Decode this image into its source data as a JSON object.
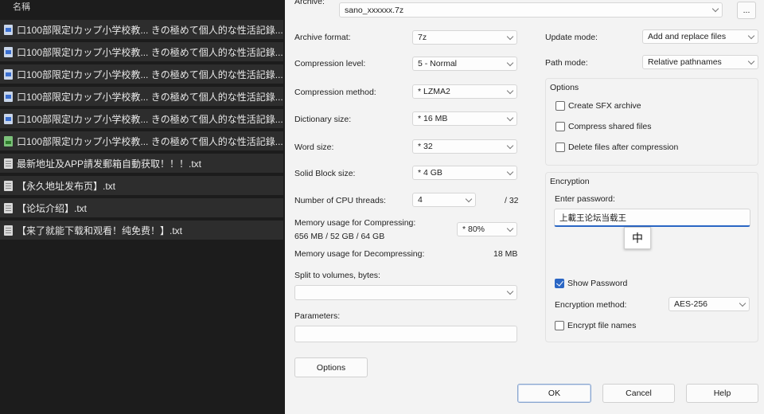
{
  "file_list": {
    "header": "名稱",
    "rows": [
      {
        "icon": "doc",
        "name": "口100部限定Iカップ小学校教... きの極めて個人的な性活記錄..."
      },
      {
        "icon": "doc",
        "name": "口100部限定Iカップ小学校教... きの極めて個人的な性活記錄..."
      },
      {
        "icon": "doc",
        "name": "口100部限定Iカップ小学校教... きの極めて個人的な性活記錄..."
      },
      {
        "icon": "doc",
        "name": "口100部限定Iカップ小学校教... きの極めて個人的な性活記錄..."
      },
      {
        "icon": "doc",
        "name": "口100部限定Iカップ小学校教... きの極めて個人的な性活記錄..."
      },
      {
        "icon": "img",
        "name": "口100部限定Iカップ小学校教... きの極めて個人的な性活記錄..."
      },
      {
        "icon": "txt",
        "name": "最新地址及APP請发郵箱自動获取！！！.txt"
      },
      {
        "icon": "txt",
        "name": "【永久地址发布页】.txt"
      },
      {
        "icon": "txt",
        "name": "【论坛介绍】.txt"
      },
      {
        "icon": "txt",
        "name": "【来了就能下载和观看！纯免费！】.txt"
      }
    ]
  },
  "dialog": {
    "archive_label": "Archive:",
    "archive_value": "sano_xxxxxx.7z",
    "browse_label": "...",
    "archive_format": {
      "label": "Archive format:",
      "value": "7z"
    },
    "compression_level": {
      "label": "Compression level:",
      "value": "5 - Normal"
    },
    "compression_method": {
      "label": "Compression method:",
      "value": "* LZMA2"
    },
    "dictionary_size": {
      "label": "Dictionary size:",
      "value": "* 16 MB"
    },
    "word_size": {
      "label": "Word size:",
      "value": "* 32"
    },
    "solid_block_size": {
      "label": "Solid Block size:",
      "value": "* 4 GB"
    },
    "cpu_threads": {
      "label": "Number of CPU threads:",
      "value": "4",
      "max": "/ 32"
    },
    "mem_compress": {
      "label_line1": "Memory usage for Compressing:",
      "label_line2": "656 MB / 52 GB / 64 GB",
      "value": "* 80%"
    },
    "mem_decompress": {
      "label": "Memory usage for Decompressing:",
      "value": "18 MB"
    },
    "split_label": "Split to volumes, bytes:",
    "parameters_label": "Parameters:",
    "options_button": "Options",
    "update_mode": {
      "label": "Update mode:",
      "value": "Add and replace files"
    },
    "path_mode": {
      "label": "Path mode:",
      "value": "Relative pathnames"
    },
    "options_group": {
      "title": "Options",
      "create_sfx": "Create SFX archive",
      "compress_shared": "Compress shared files",
      "delete_after": "Delete files after compression"
    },
    "encryption_group": {
      "title": "Encryption",
      "enter_password_label": "Enter password:",
      "password_value": "上載王论坛当载王",
      "ime_indicator": "中",
      "show_password": "Show Password",
      "method_label": "Encryption method:",
      "method_value": "AES-256",
      "encrypt_names": "Encrypt file names"
    },
    "ok_button": "OK",
    "cancel_button": "Cancel",
    "help_button": "Help"
  }
}
